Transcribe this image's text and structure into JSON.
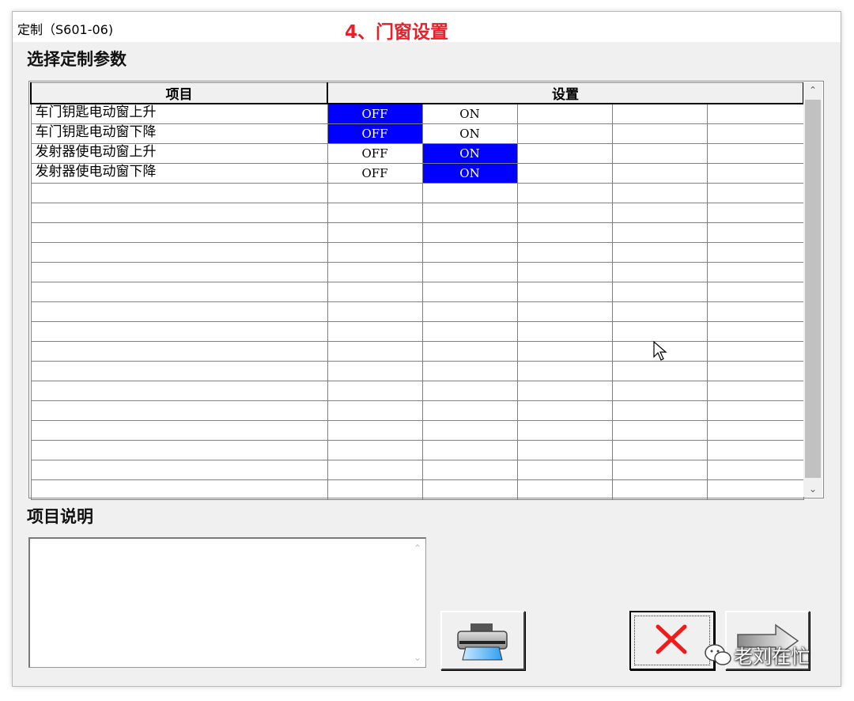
{
  "window": {
    "title": "定制（S601-06)",
    "overlay_caption": "4、门窗设置"
  },
  "params": {
    "title": "选择定制参数",
    "columns": {
      "item": "项目",
      "setting": "设置"
    },
    "rows": [
      {
        "item": "车门钥匙电动窗上升",
        "values": [
          "OFF",
          "ON",
          "",
          "",
          ""
        ],
        "selected": 0
      },
      {
        "item": "车门钥匙电动窗下降",
        "values": [
          "OFF",
          "ON",
          "",
          "",
          ""
        ],
        "selected": 0
      },
      {
        "item": "发射器使电动窗上升",
        "values": [
          "OFF",
          "ON",
          "",
          "",
          ""
        ],
        "selected": 1
      },
      {
        "item": "发射器使电动窗下降",
        "values": [
          "OFF",
          "ON",
          "",
          "",
          ""
        ],
        "selected": 1
      },
      {
        "item": "",
        "values": [
          "",
          "",
          "",
          "",
          ""
        ],
        "selected": -1
      },
      {
        "item": "",
        "values": [
          "",
          "",
          "",
          "",
          ""
        ],
        "selected": -1
      },
      {
        "item": "",
        "values": [
          "",
          "",
          "",
          "",
          ""
        ],
        "selected": -1
      },
      {
        "item": "",
        "values": [
          "",
          "",
          "",
          "",
          ""
        ],
        "selected": -1
      },
      {
        "item": "",
        "values": [
          "",
          "",
          "",
          "",
          ""
        ],
        "selected": -1
      },
      {
        "item": "",
        "values": [
          "",
          "",
          "",
          "",
          ""
        ],
        "selected": -1
      },
      {
        "item": "",
        "values": [
          "",
          "",
          "",
          "",
          ""
        ],
        "selected": -1
      },
      {
        "item": "",
        "values": [
          "",
          "",
          "",
          "",
          ""
        ],
        "selected": -1
      },
      {
        "item": "",
        "values": [
          "",
          "",
          "",
          "",
          ""
        ],
        "selected": -1
      },
      {
        "item": "",
        "values": [
          "",
          "",
          "",
          "",
          ""
        ],
        "selected": -1
      },
      {
        "item": "",
        "values": [
          "",
          "",
          "",
          "",
          ""
        ],
        "selected": -1
      },
      {
        "item": "",
        "values": [
          "",
          "",
          "",
          "",
          ""
        ],
        "selected": -1
      },
      {
        "item": "",
        "values": [
          "",
          "",
          "",
          "",
          ""
        ],
        "selected": -1
      },
      {
        "item": "",
        "values": [
          "",
          "",
          "",
          "",
          ""
        ],
        "selected": -1
      },
      {
        "item": "",
        "values": [
          "",
          "",
          "",
          "",
          ""
        ],
        "selected": -1
      },
      {
        "item": "",
        "values": [
          "",
          "",
          "",
          "",
          ""
        ],
        "selected": -1
      }
    ],
    "selected_color": "#0000ff"
  },
  "description": {
    "title": "项目说明",
    "text": ""
  },
  "buttons": {
    "print_icon": "printer-icon",
    "cancel_icon": "red-x-icon",
    "next_icon": "right-arrow-icon"
  },
  "watermark": {
    "text": "老刘在忙",
    "icon": "wechat-icon"
  }
}
